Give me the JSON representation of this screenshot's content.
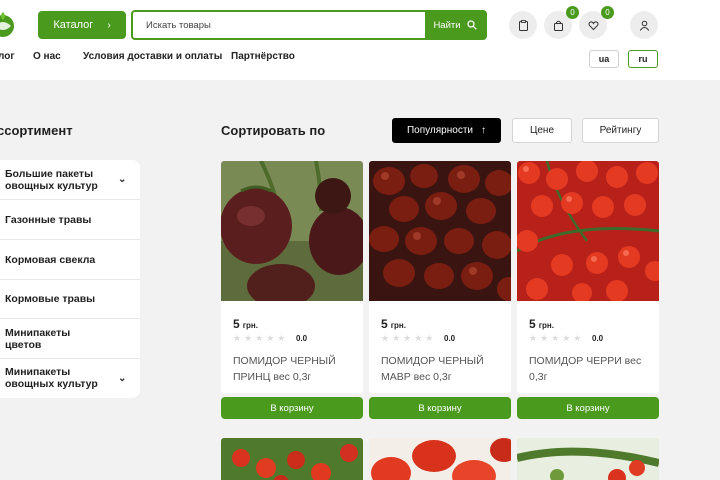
{
  "header": {
    "catalog_label": "Каталог",
    "search_placeholder": "Искать товары",
    "search_button": "Найти",
    "cart_count": "0",
    "wishlist_count": "0"
  },
  "nav": {
    "items": [
      "Блог",
      "О нас",
      "Условия доставки и оплаты",
      "Партнёрство"
    ],
    "visible_first": "лог"
  },
  "languages": [
    "ua",
    "ru"
  ],
  "sidebar": {
    "title": "Ассортимент",
    "title_visible": "ссортимент",
    "items": [
      {
        "label": "Большие пакеты овощных культур",
        "has_children": true
      },
      {
        "label": "Газонные травы",
        "has_children": false
      },
      {
        "label": "Кормовая свекла",
        "has_children": false
      },
      {
        "label": "Кормовые травы",
        "has_children": false
      },
      {
        "label": "Минипакеты цветов",
        "has_children": false
      },
      {
        "label": "Минипакеты овощных культур",
        "has_children": true
      }
    ]
  },
  "sort": {
    "label": "Сортировать по",
    "options": [
      "Популярности",
      "Цене",
      "Рейтингу"
    ],
    "active": "Популярности",
    "arrow": "↑"
  },
  "products": [
    {
      "price": "5",
      "currency": "грн.",
      "rating": "0.0",
      "name": "ПОМИДОР ЧЕРНЫЙ ПРИНЦ вес 0,3г",
      "button": "В корзину"
    },
    {
      "price": "5",
      "currency": "грн.",
      "rating": "0.0",
      "name": "ПОМИДОР ЧЕРНЫЙ МАВР вес 0,3г",
      "button": "В корзину"
    },
    {
      "price": "5",
      "currency": "грн.",
      "rating": "0.0",
      "name": "ПОМИДОР ЧЕРРИ вес 0,3г",
      "button": "В корзину"
    }
  ],
  "colors": {
    "accent": "#4a9a1e",
    "page_bg": "#f2f2f2",
    "active_sort": "#000000"
  }
}
